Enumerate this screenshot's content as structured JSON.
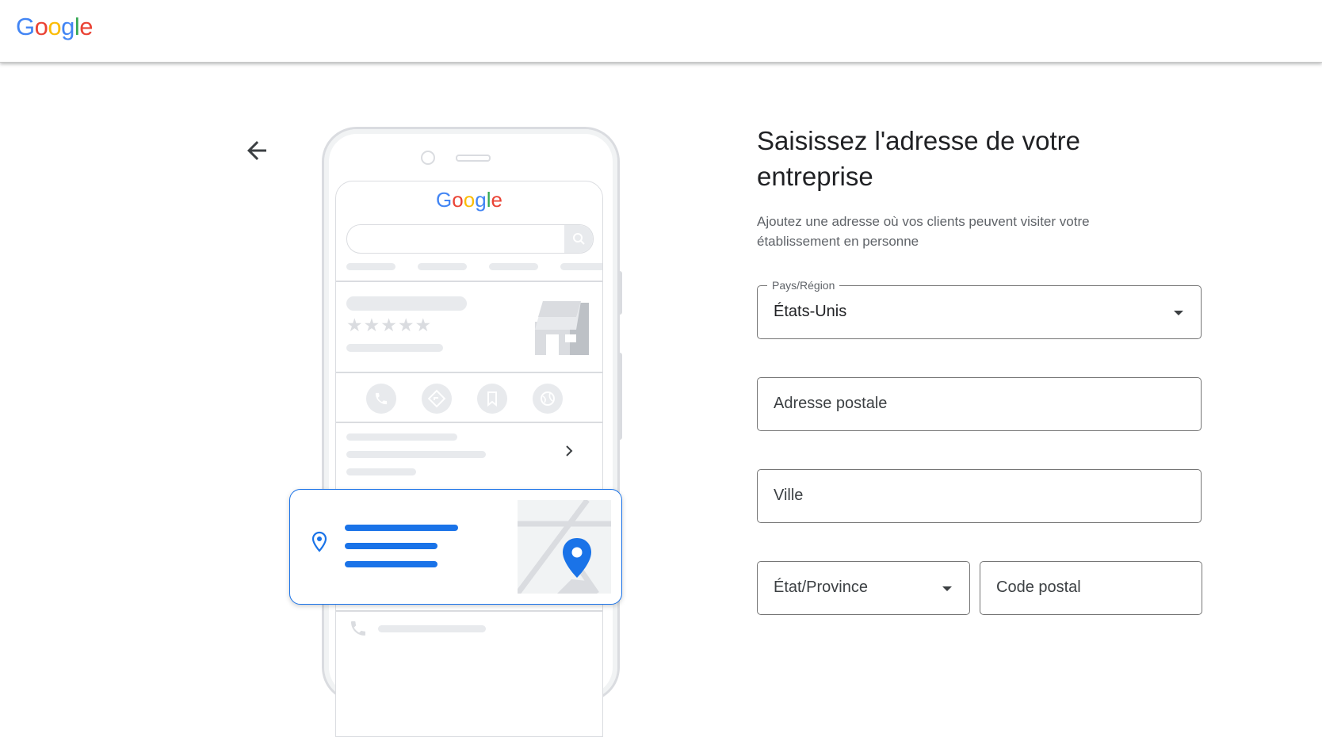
{
  "header": {
    "logo_letters": [
      {
        "ch": "G",
        "color": "#4285F4"
      },
      {
        "ch": "o",
        "color": "#EA4335"
      },
      {
        "ch": "o",
        "color": "#FBBC05"
      },
      {
        "ch": "g",
        "color": "#4285F4"
      },
      {
        "ch": "l",
        "color": "#34A853"
      },
      {
        "ch": "e",
        "color": "#EA4335"
      }
    ]
  },
  "nav": {
    "back_icon": "arrow-left-icon"
  },
  "illustration": {
    "mini_logo_letters": [
      {
        "ch": "G",
        "color": "#4285F4"
      },
      {
        "ch": "o",
        "color": "#EA4335"
      },
      {
        "ch": "o",
        "color": "#FBBC05"
      },
      {
        "ch": "g",
        "color": "#4285F4"
      },
      {
        "ch": "l",
        "color": "#34A853"
      },
      {
        "ch": "e",
        "color": "#EA4335"
      }
    ],
    "stars": "★★★★★",
    "action_icons": [
      "phone-icon",
      "directions-icon",
      "bookmark-icon",
      "globe-icon"
    ],
    "accent_color": "#1a73e8"
  },
  "form": {
    "title": "Saisissez l'adresse de votre entreprise",
    "subtitle": "Ajoutez une adresse où vos clients peuvent visiter votre établissement en personne",
    "country": {
      "label": "Pays/Région",
      "value": "États-Unis"
    },
    "street": {
      "placeholder": "Adresse postale"
    },
    "city": {
      "placeholder": "Ville"
    },
    "state": {
      "placeholder": "État/Province"
    },
    "postal": {
      "placeholder": "Code postal"
    }
  }
}
